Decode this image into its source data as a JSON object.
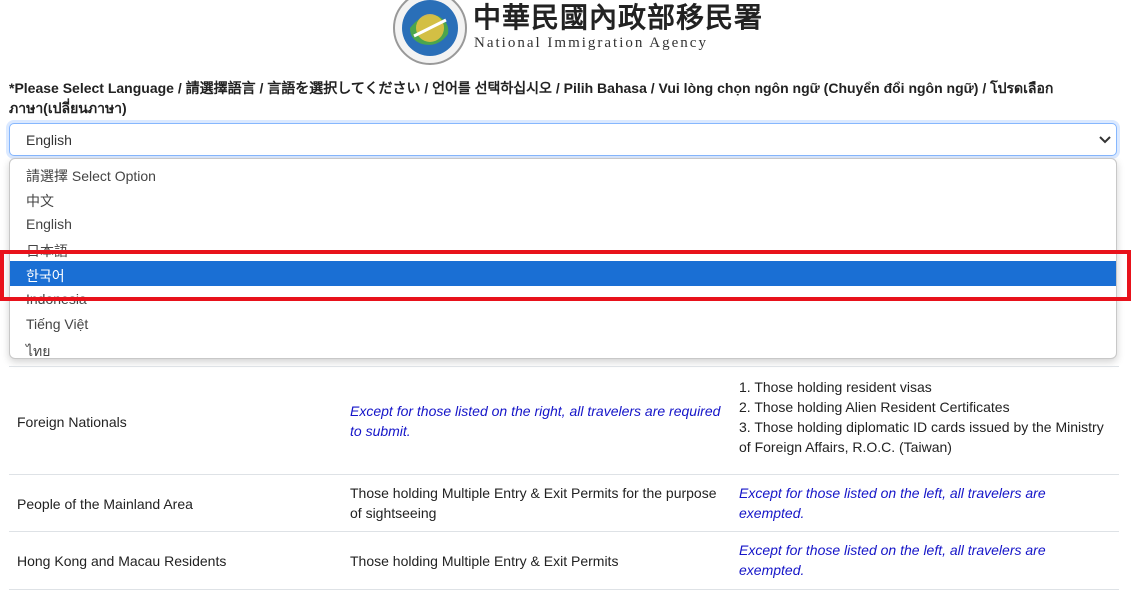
{
  "header": {
    "org_name_cn": "中華民國內政部移民署",
    "org_name_en": "National Immigration Agency",
    "logo_text": "National Immigration Agency"
  },
  "language": {
    "label": "*Please Select Language / 請選擇語言 / 言語を選択してください / 언어를 선택하십시오 / Pilih Bahasa / Vui lòng chọn ngôn ngữ (Chuyển đổi ngôn ngữ) / โปรดเลือกภาษา(เปลี่ยนภาษา)",
    "selected": "English",
    "options": [
      "請選擇 Select Option",
      "中文",
      "English",
      "日本語",
      "한국어",
      "Indonesia",
      "Tiếng Việt",
      "ไทย"
    ],
    "highlighted": "한국어"
  },
  "table": {
    "rows": [
      {
        "category": "Foreign Nationals",
        "required": "Except for those listed on the right, all travelers are required to submit.",
        "exempted": [
          "1. Those holding resident visas",
          "2. Those holding Alien Resident Certificates",
          "3. Those holding diplomatic ID cards issued by the Ministry of Foreign Affairs, R.O.C. (Taiwan)"
        ]
      },
      {
        "category": "People of the Mainland Area",
        "required": "Those holding Multiple Entry & Exit Permits for the purpose of sightseeing",
        "exempted": [
          "Except for those listed on the left, all travelers are exempted."
        ]
      },
      {
        "category": "Hong Kong and Macau Residents",
        "required": "Those holding Multiple Entry & Exit Permits",
        "exempted": [
          "Except for those listed on the left, all travelers are exempted."
        ]
      }
    ]
  },
  "colors": {
    "highlight": "#1a6fd4",
    "annotation_box": "#e8121b",
    "italic_text": "#1515c8"
  }
}
